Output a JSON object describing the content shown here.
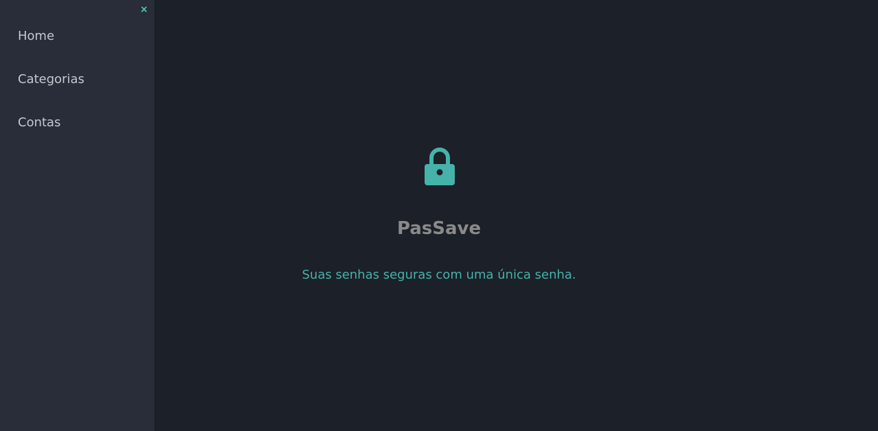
{
  "sidebar": {
    "close_label": "×",
    "items": [
      {
        "label": "Home"
      },
      {
        "label": "Categorias"
      },
      {
        "label": "Contas"
      }
    ]
  },
  "main": {
    "icon": "lock-icon",
    "title": "PasSave",
    "subtitle": "Suas senhas seguras com uma única senha."
  },
  "colors": {
    "background": "#1c2029",
    "sidebar": "#282d39",
    "accent": "#45b3aa",
    "title": "#8a8a8a",
    "nav_text": "#c4c8d0"
  }
}
